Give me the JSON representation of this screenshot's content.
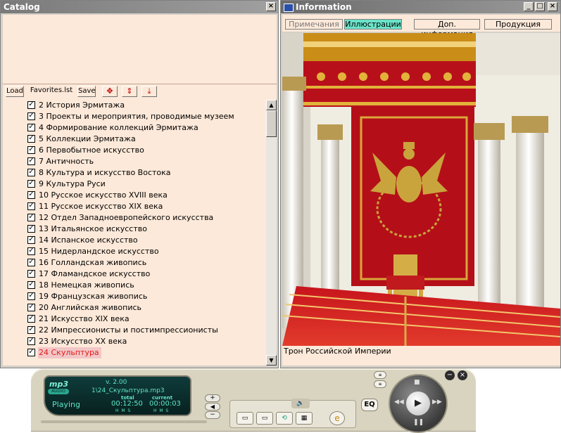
{
  "catalog": {
    "title": "Catalog",
    "toolbar": {
      "load": "Load",
      "favorites": "Favorites.lst",
      "save": "Save"
    },
    "items": [
      {
        "label": "2 История Эрмитажа",
        "checked": true
      },
      {
        "label": "3 Проекты и мероприятия, проводимые музеем",
        "checked": true
      },
      {
        "label": "4 Формирование коллекций Эрмитажа",
        "checked": true
      },
      {
        "label": "5 Коллекции Эрмитажа",
        "checked": true
      },
      {
        "label": "6 Первобытное искусство",
        "checked": true
      },
      {
        "label": "7 Античность",
        "checked": true
      },
      {
        "label": "8 Культура и искусство Востока",
        "checked": true
      },
      {
        "label": "9 Культура Руси",
        "checked": true
      },
      {
        "label": "10 Русское искусство XVIII века",
        "checked": true
      },
      {
        "label": "11 Русское искусство XIX века",
        "checked": true
      },
      {
        "label": "12 Отдел Западноевропейского искусства",
        "checked": true
      },
      {
        "label": "13 Итальянское искусство",
        "checked": true
      },
      {
        "label": "14 Испанское искусство",
        "checked": true
      },
      {
        "label": "15 Нидерландское искусство",
        "checked": true
      },
      {
        "label": "16 Голландская живопись",
        "checked": true
      },
      {
        "label": "17 Фламандское искусство",
        "checked": true
      },
      {
        "label": "18 Немецкая живопись",
        "checked": true
      },
      {
        "label": "19 Французская живопись",
        "checked": true
      },
      {
        "label": "20 Английская живопись",
        "checked": true
      },
      {
        "label": "21 Искусство XIX века",
        "checked": true
      },
      {
        "label": "22 Импрессионисты и постимпрессионисты",
        "checked": true
      },
      {
        "label": "23 Искусство XX века",
        "checked": true
      },
      {
        "label": "24 Скульптура",
        "checked": true,
        "selected": true
      }
    ]
  },
  "info": {
    "title": "Information",
    "tabs": [
      {
        "label": "Примечания",
        "state": "inactive"
      },
      {
        "label": "Иллюстрации",
        "state": "active"
      },
      {
        "label": "Доп. информация",
        "state": "normal"
      },
      {
        "label": "Продукция",
        "state": "normal"
      }
    ],
    "caption": "Трон Российской Империи"
  },
  "player": {
    "logo": "mp3",
    "audio_badge": "AUDIO",
    "version": "v. 2.00",
    "track": "1\\24_Скульптура.mp3",
    "status": "Playing",
    "total_label": "total",
    "current_label": "current",
    "total_time": "00:12:50",
    "current_time": "00:00:03",
    "hms": "H  M  S",
    "eq_label": "EQ",
    "colors": {
      "lcd_text": "#5fe4c7",
      "body": "#d9d4c0"
    }
  }
}
